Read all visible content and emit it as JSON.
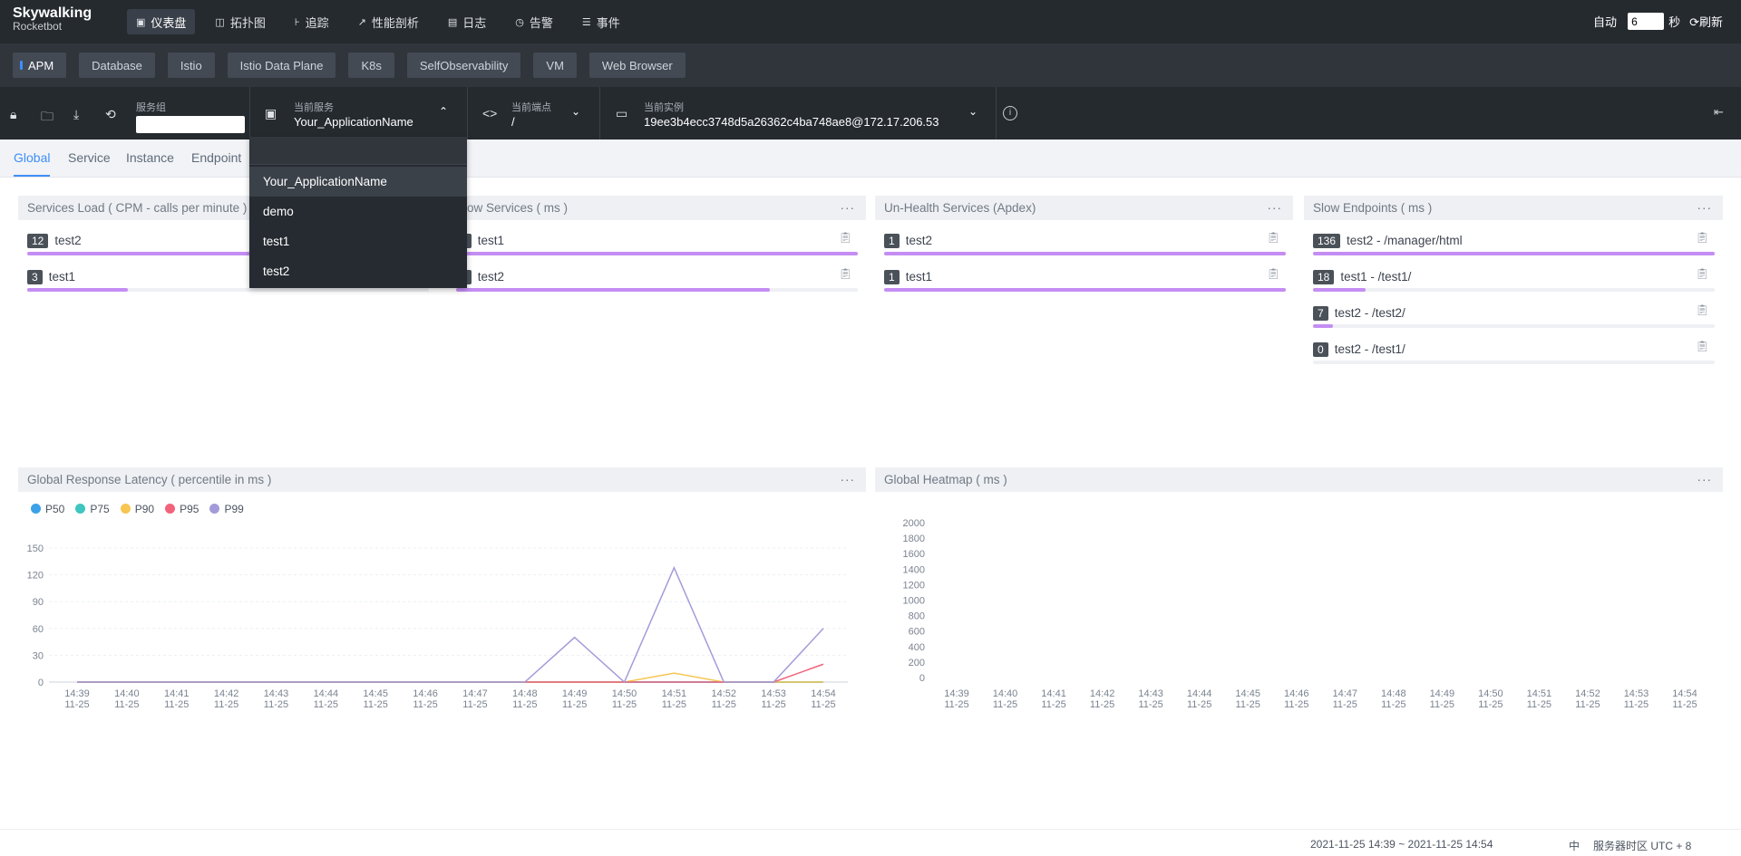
{
  "logo": {
    "title": "Skywalking",
    "subtitle": "Rocketbot"
  },
  "nav": [
    {
      "icon": "▣",
      "label": "仪表盘",
      "active": true
    },
    {
      "icon": "◫",
      "label": "拓扑图"
    },
    {
      "icon": "⊦",
      "label": "追踪"
    },
    {
      "icon": "↗",
      "label": "性能剖析"
    },
    {
      "icon": "▤",
      "label": "日志"
    },
    {
      "icon": "◷",
      "label": "告警"
    },
    {
      "icon": "☰",
      "label": "事件"
    }
  ],
  "auto_refresh": {
    "label": "自动",
    "interval": "6",
    "unit": "秒",
    "refresh_label": "刷新"
  },
  "dashboard_tabs": [
    "APM",
    "Database",
    "Istio",
    "Istio Data Plane",
    "K8s",
    "SelfObservability",
    "VM",
    "Web Browser"
  ],
  "toolbar": {
    "service_group_label": "服务组",
    "current_service_label": "当前服务",
    "current_service_value": "Your_ApplicationName",
    "current_endpoint_label": "当前端点",
    "current_endpoint_value": "/",
    "current_instance_label": "当前实例",
    "current_instance_value": "19ee3b4ecc3748d5a26362c4ba748ae8@172.17.206.53"
  },
  "subtabs": [
    "Global",
    "Service",
    "Instance",
    "Endpoint"
  ],
  "service_dropdown": [
    "Your_ApplicationName",
    "demo",
    "test1",
    "test2"
  ],
  "panels": {
    "services_load": {
      "title": "Services Load ( CPM - calls per minute )",
      "rows": [
        {
          "value": "12",
          "name": "test2",
          "pct": 100
        },
        {
          "value": "3",
          "name": "test1",
          "pct": 25
        }
      ]
    },
    "slow_services": {
      "title": "Slow Services ( ms )",
      "rows": [
        {
          "value": "8",
          "name": "test1",
          "pct": 100
        },
        {
          "value": "4",
          "name": "test2",
          "pct": 78
        }
      ]
    },
    "unhealth_services": {
      "title": "Un-Health Services (Apdex)",
      "rows": [
        {
          "value": "1",
          "name": "test2",
          "pct": 100
        },
        {
          "value": "1",
          "name": "test1",
          "pct": 100
        }
      ]
    },
    "slow_endpoints": {
      "title": "Slow Endpoints ( ms )",
      "rows": [
        {
          "value": "136",
          "name": "test2 - /manager/html",
          "pct": 100
        },
        {
          "value": "18",
          "name": "test1 - /test1/",
          "pct": 13
        },
        {
          "value": "7",
          "name": "test2 - /test2/",
          "pct": 5
        },
        {
          "value": "0",
          "name": "test2 - /test1/",
          "pct": 0
        }
      ]
    },
    "latency": {
      "title": "Global Response Latency ( percentile in ms )"
    },
    "heatmap": {
      "title": "Global Heatmap ( ms )"
    }
  },
  "chart_data": [
    {
      "type": "line",
      "title": "Global Response Latency ( percentile in ms )",
      "categories": [
        "14:39\n11-25",
        "14:40\n11-25",
        "14:41\n11-25",
        "14:42\n11-25",
        "14:43\n11-25",
        "14:44\n11-25",
        "14:45\n11-25",
        "14:46\n11-25",
        "14:47\n11-25",
        "14:48\n11-25",
        "14:49\n11-25",
        "14:50\n11-25",
        "14:51\n11-25",
        "14:52\n11-25",
        "14:53\n11-25",
        "14:54\n11-25"
      ],
      "ylim": [
        0,
        150
      ],
      "yticks": [
        0,
        30,
        60,
        90,
        120,
        150
      ],
      "grid": true,
      "legend": "top-left",
      "series": [
        {
          "name": "P50",
          "color": "#3ba1e8",
          "values": [
            0,
            0,
            0,
            0,
            0,
            0,
            0,
            0,
            0,
            0,
            0,
            0,
            0,
            0,
            0,
            0
          ]
        },
        {
          "name": "P75",
          "color": "#3ec6c0",
          "values": [
            0,
            0,
            0,
            0,
            0,
            0,
            0,
            0,
            0,
            0,
            0,
            0,
            0,
            0,
            0,
            0
          ]
        },
        {
          "name": "P90",
          "color": "#f6c651",
          "values": [
            0,
            0,
            0,
            0,
            0,
            0,
            0,
            0,
            0,
            0,
            0,
            0,
            10,
            0,
            0,
            0
          ]
        },
        {
          "name": "P95",
          "color": "#f2637b",
          "values": [
            0,
            0,
            0,
            0,
            0,
            0,
            0,
            0,
            0,
            0,
            0,
            0,
            0,
            0,
            0,
            20
          ]
        },
        {
          "name": "P99",
          "color": "#a39bd9",
          "values": [
            0,
            0,
            0,
            0,
            0,
            0,
            0,
            0,
            0,
            0,
            50,
            0,
            128,
            0,
            0,
            60
          ]
        }
      ]
    },
    {
      "type": "heatmap",
      "title": "Global Heatmap ( ms )",
      "categories": [
        "14:39\n11-25",
        "14:40\n11-25",
        "14:41\n11-25",
        "14:42\n11-25",
        "14:43\n11-25",
        "14:44\n11-25",
        "14:45\n11-25",
        "14:46\n11-25",
        "14:47\n11-25",
        "14:48\n11-25",
        "14:49\n11-25",
        "14:50\n11-25",
        "14:51\n11-25",
        "14:52\n11-25",
        "14:53\n11-25",
        "14:54\n11-25"
      ],
      "yticks": [
        0,
        200,
        400,
        600,
        800,
        1000,
        1200,
        1400,
        1600,
        1800,
        2000
      ],
      "values": []
    }
  ],
  "footer": {
    "time_range": "2021-11-25 14:39 ~ 2021-11-25 14:54",
    "lang": "中",
    "timezone": "服务器时区 UTC + 8"
  }
}
